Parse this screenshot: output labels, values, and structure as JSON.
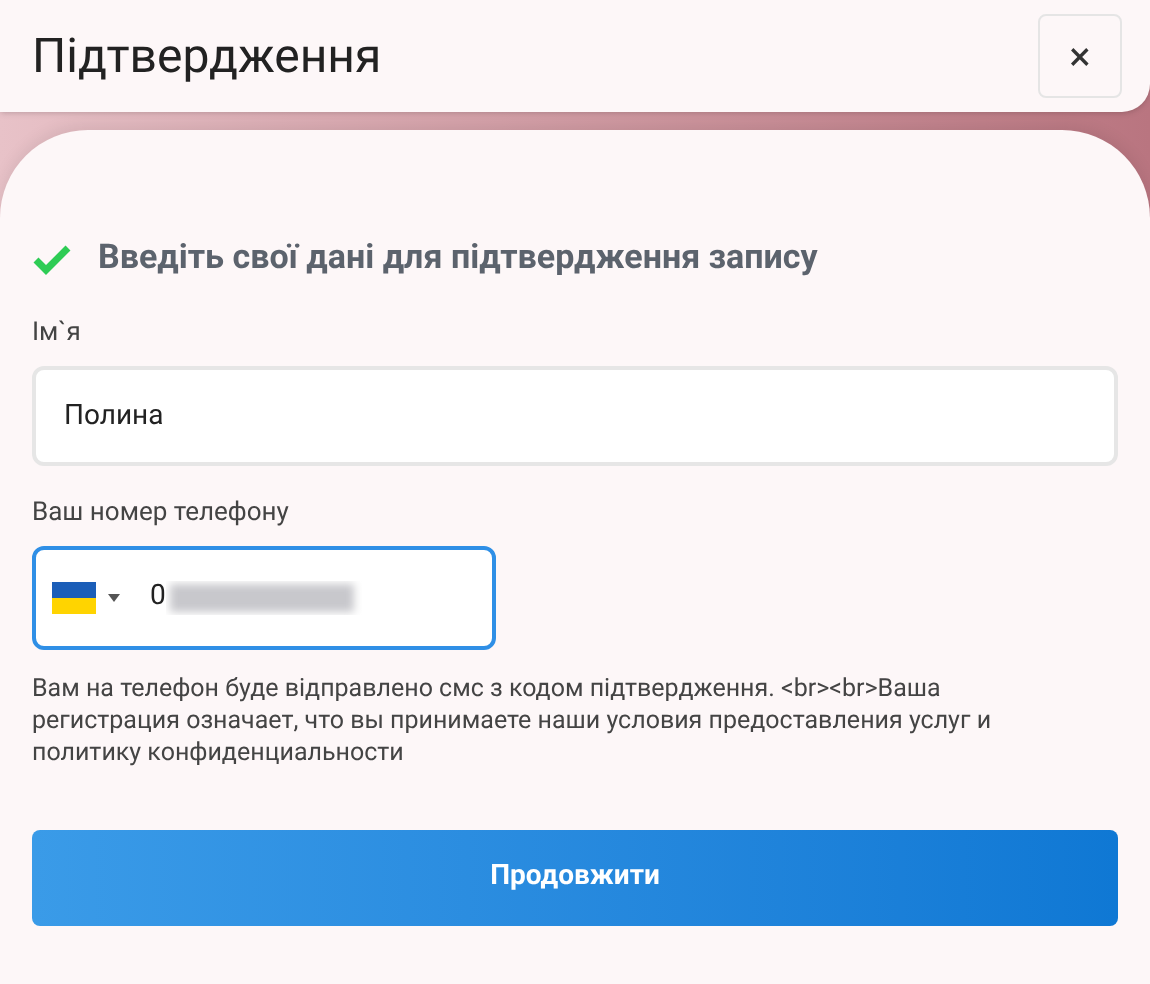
{
  "header": {
    "title": "Підтвердження",
    "close": "×"
  },
  "form": {
    "heading": "Введіть свої дані для підтвердження запису",
    "name_field": {
      "label": "Ім`я",
      "value": "Полина"
    },
    "phone_field": {
      "label": "Ваш номер телефону",
      "value": "0",
      "focused": true
    },
    "notice": "Вам на телефон буде відправлено смс з кодом підтвердження. <br><br>Ваша регистрация означает, что вы принимаете наши условия предоставления услуг и политику конфиденциальности",
    "submit": "Продовжити"
  }
}
